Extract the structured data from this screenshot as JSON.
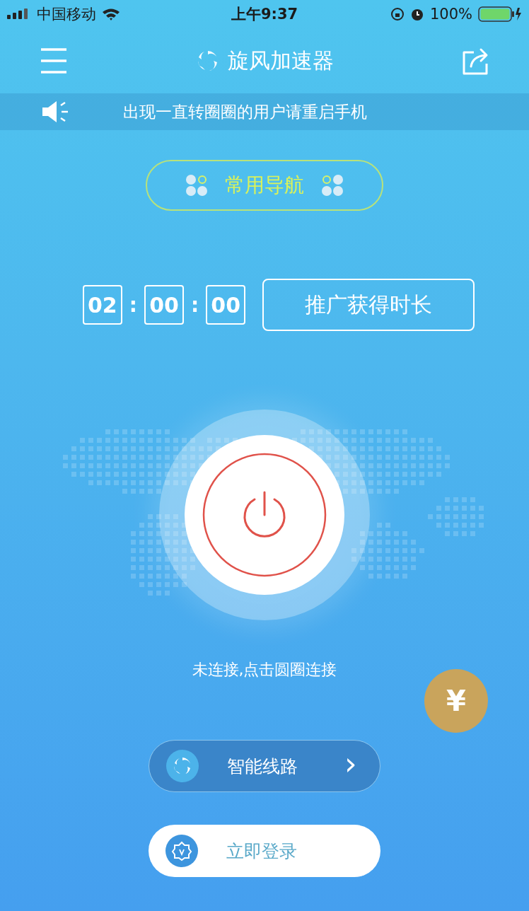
{
  "status_bar": {
    "carrier": "中国移动",
    "time": "上午9:37",
    "battery_percent": "100%"
  },
  "header": {
    "title": "旋风加速器"
  },
  "notice": {
    "text": "出现一直转圈圈的用户请重启手机"
  },
  "nav_button": {
    "label": "常用导航"
  },
  "timer": {
    "parts": [
      "02",
      "00",
      "00"
    ],
    "separator": ":"
  },
  "promo_button": {
    "label": "推广获得时长"
  },
  "connection": {
    "connected": false,
    "hint": "未连接,点击圆圈连接"
  },
  "coin_button": {
    "label": "¥"
  },
  "route_button": {
    "label": "智能线路",
    "arrow": "›"
  },
  "login_button": {
    "label": "立即登录"
  }
}
